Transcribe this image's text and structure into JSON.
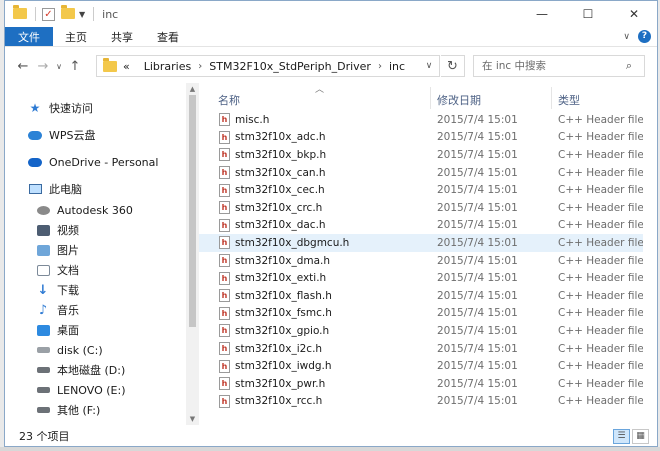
{
  "window": {
    "title": "inc",
    "controls": {
      "minimize": "—",
      "maximize": "☐",
      "close": "✕"
    }
  },
  "ribbon": {
    "file_tab": "文件",
    "tabs": [
      "主页",
      "共享",
      "查看"
    ],
    "help_icon": "?"
  },
  "nav": {
    "back": "←",
    "forward": "→",
    "recent": "∨",
    "up": "↑",
    "address_prefix": "«",
    "breadcrumb": [
      "Libraries",
      "STM32F10x_StdPeriph_Driver",
      "inc"
    ],
    "search_placeholder": "在 inc 中搜索"
  },
  "sidebar": {
    "items": [
      {
        "label": "快速访问",
        "icon": "star-icon"
      },
      {
        "label": "WPS云盘",
        "icon": "wps-cloud-icon"
      },
      {
        "label": "OneDrive - Personal",
        "icon": "onedrive-icon"
      },
      {
        "label": "此电脑",
        "icon": "pc-icon"
      },
      {
        "label": "Autodesk 360",
        "icon": "autodesk-icon"
      },
      {
        "label": "视频",
        "icon": "video-icon"
      },
      {
        "label": "图片",
        "icon": "pictures-icon"
      },
      {
        "label": "文档",
        "icon": "documents-icon"
      },
      {
        "label": "下载",
        "icon": "download-icon"
      },
      {
        "label": "音乐",
        "icon": "music-icon"
      },
      {
        "label": "桌面",
        "icon": "desktop-icon"
      },
      {
        "label": "disk (C:)",
        "icon": "drive-icon"
      },
      {
        "label": "本地磁盘 (D:)",
        "icon": "drive-icon"
      },
      {
        "label": "LENOVO (E:)",
        "icon": "drive-icon"
      },
      {
        "label": "其他 (F:)",
        "icon": "drive-icon"
      }
    ]
  },
  "list": {
    "columns": {
      "name": "名称",
      "date": "修改日期",
      "type": "类型"
    },
    "rows": [
      {
        "name": "misc.h",
        "date": "2015/7/4 15:01",
        "type": "C++ Header file"
      },
      {
        "name": "stm32f10x_adc.h",
        "date": "2015/7/4 15:01",
        "type": "C++ Header file"
      },
      {
        "name": "stm32f10x_bkp.h",
        "date": "2015/7/4 15:01",
        "type": "C++ Header file"
      },
      {
        "name": "stm32f10x_can.h",
        "date": "2015/7/4 15:01",
        "type": "C++ Header file"
      },
      {
        "name": "stm32f10x_cec.h",
        "date": "2015/7/4 15:01",
        "type": "C++ Header file"
      },
      {
        "name": "stm32f10x_crc.h",
        "date": "2015/7/4 15:01",
        "type": "C++ Header file"
      },
      {
        "name": "stm32f10x_dac.h",
        "date": "2015/7/4 15:01",
        "type": "C++ Header file"
      },
      {
        "name": "stm32f10x_dbgmcu.h",
        "date": "2015/7/4 15:01",
        "type": "C++ Header file",
        "selected": true
      },
      {
        "name": "stm32f10x_dma.h",
        "date": "2015/7/4 15:01",
        "type": "C++ Header file"
      },
      {
        "name": "stm32f10x_exti.h",
        "date": "2015/7/4 15:01",
        "type": "C++ Header file"
      },
      {
        "name": "stm32f10x_flash.h",
        "date": "2015/7/4 15:01",
        "type": "C++ Header file"
      },
      {
        "name": "stm32f10x_fsmc.h",
        "date": "2015/7/4 15:01",
        "type": "C++ Header file"
      },
      {
        "name": "stm32f10x_gpio.h",
        "date": "2015/7/4 15:01",
        "type": "C++ Header file"
      },
      {
        "name": "stm32f10x_i2c.h",
        "date": "2015/7/4 15:01",
        "type": "C++ Header file"
      },
      {
        "name": "stm32f10x_iwdg.h",
        "date": "2015/7/4 15:01",
        "type": "C++ Header file"
      },
      {
        "name": "stm32f10x_pwr.h",
        "date": "2015/7/4 15:01",
        "type": "C++ Header file"
      },
      {
        "name": "stm32f10x_rcc.h",
        "date": "2015/7/4 15:01",
        "type": "C++ Header file"
      }
    ]
  },
  "status": {
    "count_text": "23 个项目"
  },
  "colors": {
    "accent": "#1e6fc2",
    "selected_row": "#e5f1fb"
  }
}
